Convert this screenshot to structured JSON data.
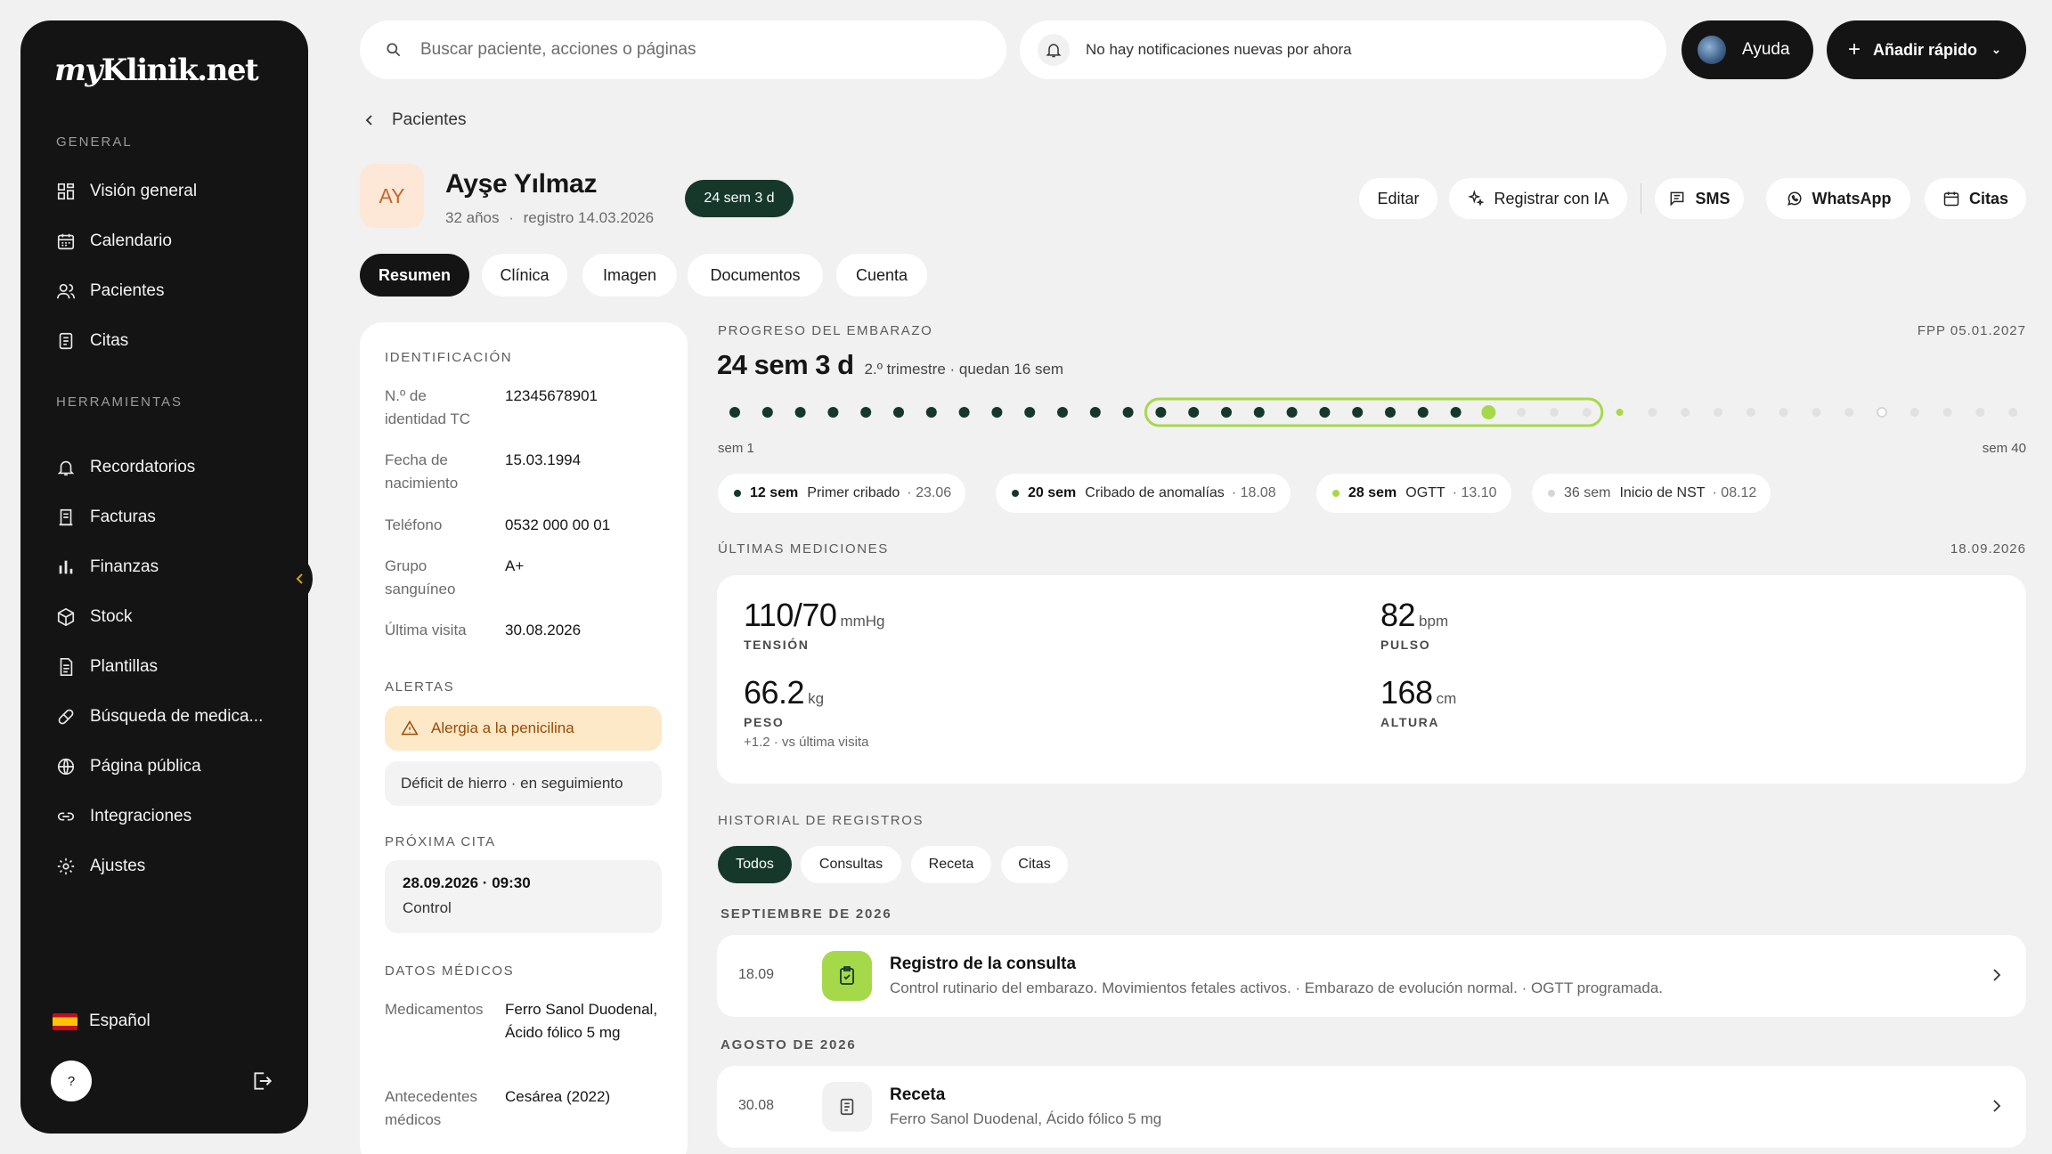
{
  "sidebar": {
    "logo": {
      "prefix": "my",
      "rest": "Klinik.net"
    },
    "section_general": "GENERAL",
    "general_items": [
      {
        "label": "Visión general",
        "icon": "grid-icon"
      },
      {
        "label": "Calendario",
        "icon": "calendar-icon"
      },
      {
        "label": "Pacientes",
        "icon": "users-icon"
      },
      {
        "label": "Citas",
        "icon": "clipboard-icon"
      }
    ],
    "section_tools": "HERRAMIENTAS",
    "tool_items": [
      {
        "label": "Recordatorios",
        "icon": "bell-icon"
      },
      {
        "label": "Facturas",
        "icon": "receipt-icon"
      },
      {
        "label": "Finanzas",
        "icon": "bar-chart-icon"
      },
      {
        "label": "Stock",
        "icon": "box-icon"
      },
      {
        "label": "Plantillas",
        "icon": "document-icon"
      },
      {
        "label": "Búsqueda de medica...",
        "icon": "pill-icon"
      },
      {
        "label": "Página pública",
        "icon": "globe-icon"
      },
      {
        "label": "Integraciones",
        "icon": "link-icon"
      },
      {
        "label": "Ajustes",
        "icon": "gear-icon"
      }
    ],
    "language": "Español",
    "help_symbol": "?"
  },
  "topbar": {
    "search_placeholder": "Buscar paciente, acciones o páginas",
    "notifications": "No hay notificaciones nuevas por ahora",
    "help_label": "Ayuda",
    "quick_add_label": "Añadir rápido"
  },
  "breadcrumb": "Pacientes",
  "patient": {
    "initials": "AY",
    "name": "Ayşe Yılmaz",
    "age": "32 años",
    "registered": "registro 14.03.2026",
    "week_badge": "24 sem 3 d"
  },
  "actions": {
    "edit": "Editar",
    "ai": "Registrar con IA",
    "sms": "SMS",
    "whatsapp": "WhatsApp",
    "appointments": "Citas"
  },
  "tabs": [
    "Resumen",
    "Clínica",
    "Imagen",
    "Documentos",
    "Cuenta"
  ],
  "identification": {
    "title": "IDENTIFICACIÓN",
    "rows": [
      {
        "label": "N.º de identidad TC",
        "value": "12345678901"
      },
      {
        "label": "Fecha de nacimiento",
        "value": "15.03.1994"
      },
      {
        "label": "Teléfono",
        "value": "0532 000 00 01"
      },
      {
        "label": "Grupo sanguíneo",
        "value": "A+"
      },
      {
        "label": "Última visita",
        "value": "30.08.2026"
      }
    ]
  },
  "alerts": {
    "title": "ALERTAS",
    "warning": "Alergia a la penicilina",
    "info": "Déficit de hierro · en seguimiento"
  },
  "next_appointment": {
    "title": "PRÓXIMA CITA",
    "date": "28.09.2026 · 09:30",
    "type": "Control"
  },
  "medical": {
    "title": "DATOS MÉDICOS",
    "medications_label": "Medicamentos",
    "medications_value": "Ferro Sanol Duodenal, Ácido fólico 5 mg",
    "history_label": "Antecedentes médicos",
    "history_value": "Cesárea (2022)"
  },
  "pregnancy": {
    "title": "PROGRESO DEL EMBARAZO",
    "due_date": "FPP 05.01.2027",
    "week_text": "24 sem 3 d",
    "detail": "2.º trimestre · quedan 16 sem",
    "start_label": "sem 1",
    "end_label": "sem 40",
    "total_weeks": 40,
    "current_week": 24,
    "second_trimester": [
      14,
      27
    ],
    "colors": {
      "done": "#15382b",
      "current": "#a6d94a",
      "future": "#e1e1e1",
      "trimester": "#a6d94a"
    },
    "milestones": [
      {
        "week": "12 sem",
        "label": "Primer cribado",
        "date": "· 23.06",
        "dot": "#15382b"
      },
      {
        "week": "20 sem",
        "label": "Cribado de anomalías",
        "date": "· 18.08",
        "dot": "#15382b"
      },
      {
        "week": "28 sem",
        "label": "OGTT",
        "date": "· 13.10",
        "dot": "#a6d94a"
      },
      {
        "week": "36 sem",
        "label": "Inicio de NST",
        "date": "· 08.12",
        "dot": "#d6d6d6"
      }
    ]
  },
  "measurements": {
    "title": "ÚLTIMAS MEDICIONES",
    "date": "18.09.2026",
    "bp": {
      "value": "110/70",
      "unit": "mmHg",
      "label": "TENSIÓN"
    },
    "pulse": {
      "value": "82",
      "unit": "bpm",
      "label": "PULSO"
    },
    "weight": {
      "value": "66.2",
      "unit": "kg",
      "label": "PESO",
      "note": "+1.2 · vs última visita"
    },
    "height": {
      "value": "168",
      "unit": "cm",
      "label": "ALTURA"
    }
  },
  "history": {
    "title": "HISTORIAL DE REGISTROS",
    "filters": [
      "Todos",
      "Consultas",
      "Receta",
      "Citas"
    ],
    "groups": [
      {
        "month": "SEPTIEMBRE DE 2026",
        "date": "18.09",
        "title": "Registro de la consulta",
        "desc": "Control rutinario del embarazo. Movimientos fetales activos. · Embarazo de evolución normal. · OGTT programada.",
        "icon": "clipboard-check-icon"
      },
      {
        "month": "AGOSTO DE 2026",
        "date": "30.08",
        "title": "Receta",
        "desc": "Ferro Sanol Duodenal, Ácido fólico 5 mg",
        "icon": "prescription-icon"
      }
    ]
  }
}
